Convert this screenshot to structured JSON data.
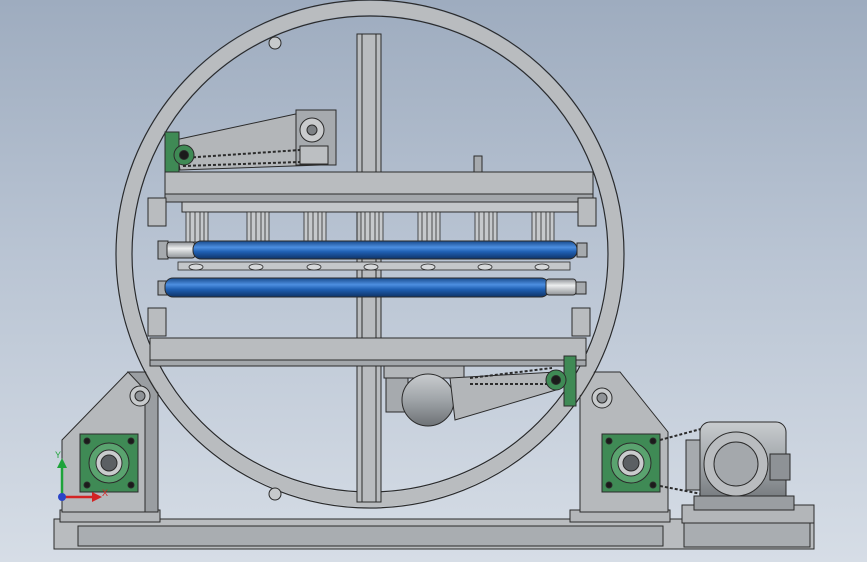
{
  "view": {
    "title": "",
    "background_top": "#9eacbf",
    "background_bottom": "#d6dde6"
  },
  "colors": {
    "frame_gray": "#b9bcbf",
    "frame_dark": "#8e9296",
    "outline": "#2b2b2b",
    "roller_blue": "#1f5fb2",
    "roller_highlight": "#4d8fe0",
    "bearing_green": "#3f8a55",
    "motor_gray": "#9fa4a8"
  },
  "parts": {
    "drum_ring": "rotating-drum-ring",
    "upper_roller": "upper-blue-roller",
    "lower_roller": "lower-blue-roller",
    "left_pillow_block": "left-bearing-housing",
    "right_pillow_block": "right-bearing-housing",
    "drive_motor": "drive-motor",
    "chain_drive": "chain-drive",
    "base_frame": "base-frame"
  },
  "icons": {
    "triad": "coordinate-triad-icon"
  },
  "triad": {
    "x_label": "X",
    "y_label": "Y"
  }
}
